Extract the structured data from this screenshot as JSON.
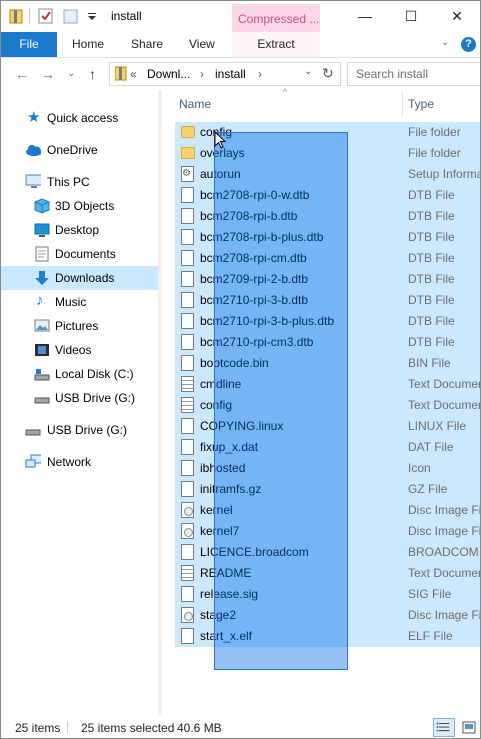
{
  "titlebar": {
    "title": "install",
    "context_tab": "Compressed ...",
    "minimize_icon": "minimize-icon",
    "maximize_icon": "maximize-icon",
    "close_icon": "close-icon",
    "min_glyph": "—",
    "max_glyph": "☐",
    "close_glyph": "✕"
  },
  "ribbon": {
    "tabs": [
      "File",
      "Home",
      "Share",
      "View",
      "Extract"
    ],
    "help": "?",
    "collapse_glyph": "⌄"
  },
  "address": {
    "back_glyph": "←",
    "forward_glyph": "→",
    "recent_glyph": "⌄",
    "up_glyph": "↑",
    "overflow": "«",
    "segment1": "Downl...",
    "separator": "›",
    "segment2": "install",
    "refresh_glyph": "↻",
    "dropdown_glyph": "⌄",
    "search_placeholder": "Search install"
  },
  "sidebar": {
    "items": [
      {
        "label": "Quick access",
        "icon": "star-icon"
      },
      {
        "label": "OneDrive",
        "icon": "cloud-icon"
      },
      {
        "label": "This PC",
        "icon": "computer-icon"
      },
      {
        "label": "3D Objects",
        "icon": "cube-icon"
      },
      {
        "label": "Desktop",
        "icon": "desktop-icon"
      },
      {
        "label": "Documents",
        "icon": "document-icon"
      },
      {
        "label": "Downloads",
        "icon": "download-icon"
      },
      {
        "label": "Music",
        "icon": "music-icon"
      },
      {
        "label": "Pictures",
        "icon": "picture-icon"
      },
      {
        "label": "Videos",
        "icon": "video-icon"
      },
      {
        "label": "Local Disk (C:)",
        "icon": "drive-icon"
      },
      {
        "label": "USB Drive (G:)",
        "icon": "usb-drive-icon"
      },
      {
        "label": "USB Drive (G:)",
        "icon": "usb-drive-icon"
      },
      {
        "label": "Network",
        "icon": "network-icon"
      }
    ],
    "selected": "Downloads"
  },
  "columns": {
    "name": "Name",
    "type": "Type",
    "sort_glyph": "^"
  },
  "files": [
    {
      "name": "config",
      "type": "File folder",
      "icon": "folder"
    },
    {
      "name": "overlays",
      "type": "File folder",
      "icon": "folder"
    },
    {
      "name": "autorun",
      "type": "Setup Informa",
      "icon": "gear"
    },
    {
      "name": "bcm2708-rpi-0-w.dtb",
      "type": "DTB File",
      "icon": "doc"
    },
    {
      "name": "bcm2708-rpi-b.dtb",
      "type": "DTB File",
      "icon": "doc"
    },
    {
      "name": "bcm2708-rpi-b-plus.dtb",
      "type": "DTB File",
      "icon": "doc"
    },
    {
      "name": "bcm2708-rpi-cm.dtb",
      "type": "DTB File",
      "icon": "doc"
    },
    {
      "name": "bcm2709-rpi-2-b.dtb",
      "type": "DTB File",
      "icon": "doc"
    },
    {
      "name": "bcm2710-rpi-3-b.dtb",
      "type": "DTB File",
      "icon": "doc"
    },
    {
      "name": "bcm2710-rpi-3-b-plus.dtb",
      "type": "DTB File",
      "icon": "doc"
    },
    {
      "name": "bcm2710-rpi-cm3.dtb",
      "type": "DTB File",
      "icon": "doc"
    },
    {
      "name": "bootcode.bin",
      "type": "BIN File",
      "icon": "doc"
    },
    {
      "name": "cmdline",
      "type": "Text Documen",
      "icon": "doc-lines"
    },
    {
      "name": "config",
      "type": "Text Documen",
      "icon": "doc-lines"
    },
    {
      "name": "COPYING.linux",
      "type": "LINUX File",
      "icon": "doc"
    },
    {
      "name": "fixup_x.dat",
      "type": "DAT File",
      "icon": "doc"
    },
    {
      "name": "ibhosted",
      "type": "Icon",
      "icon": "doc"
    },
    {
      "name": "initramfs.gz",
      "type": "GZ File",
      "icon": "doc"
    },
    {
      "name": "kernel",
      "type": "Disc Image Fil",
      "icon": "disc"
    },
    {
      "name": "kernel7",
      "type": "Disc Image Fil",
      "icon": "disc"
    },
    {
      "name": "LICENCE.broadcom",
      "type": "BROADCOM F",
      "icon": "doc"
    },
    {
      "name": "README",
      "type": "Text Documen",
      "icon": "doc-lines"
    },
    {
      "name": "release.sig",
      "type": "SIG File",
      "icon": "doc"
    },
    {
      "name": "stage2",
      "type": "Disc Image Fil",
      "icon": "disc"
    },
    {
      "name": "start_x.elf",
      "type": "ELF File",
      "icon": "doc"
    }
  ],
  "status": {
    "items": "25 items",
    "selected": "25 items selected",
    "size": "40.6 MB"
  },
  "colors": {
    "accent": "#1979ca",
    "selection": "#cce8ff",
    "marquee": "#3d8ee6",
    "context_tab": "#fbd6e6"
  }
}
